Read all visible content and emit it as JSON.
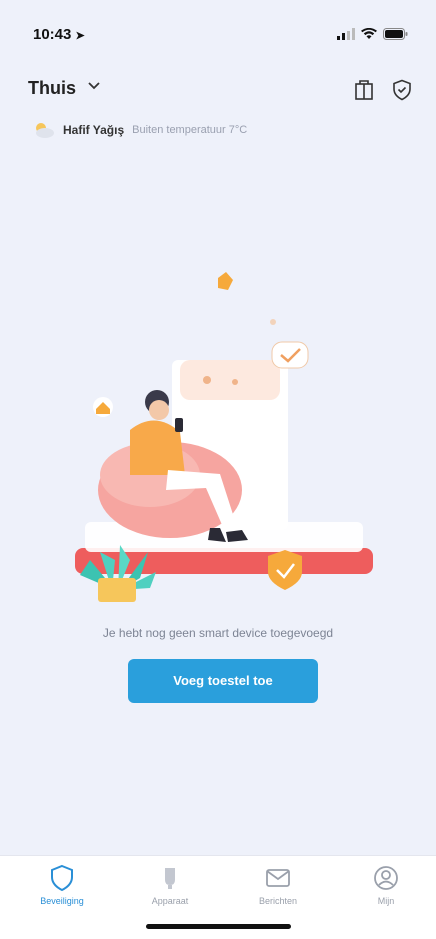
{
  "status_bar": {
    "time": "10:43"
  },
  "header": {
    "home_name": "Thuis"
  },
  "weather": {
    "location": "Hafif Yağış",
    "detail": "Buiten temperatuur 7°C"
  },
  "empty_state": {
    "message": "Je hebt nog geen smart device toegevoegd",
    "add_button": "Voeg toestel toe"
  },
  "tabs": [
    {
      "label": "Beveiliging",
      "icon": "shield-icon",
      "active": true
    },
    {
      "label": "Apparaat",
      "icon": "device-icon",
      "active": false
    },
    {
      "label": "Berichten",
      "icon": "mail-icon",
      "active": false
    },
    {
      "label": "Mijn",
      "icon": "profile-icon",
      "active": false
    }
  ],
  "colors": {
    "background": "#eef1fa",
    "accent": "#2a9fdc",
    "active_tab": "#2a8fd6"
  }
}
